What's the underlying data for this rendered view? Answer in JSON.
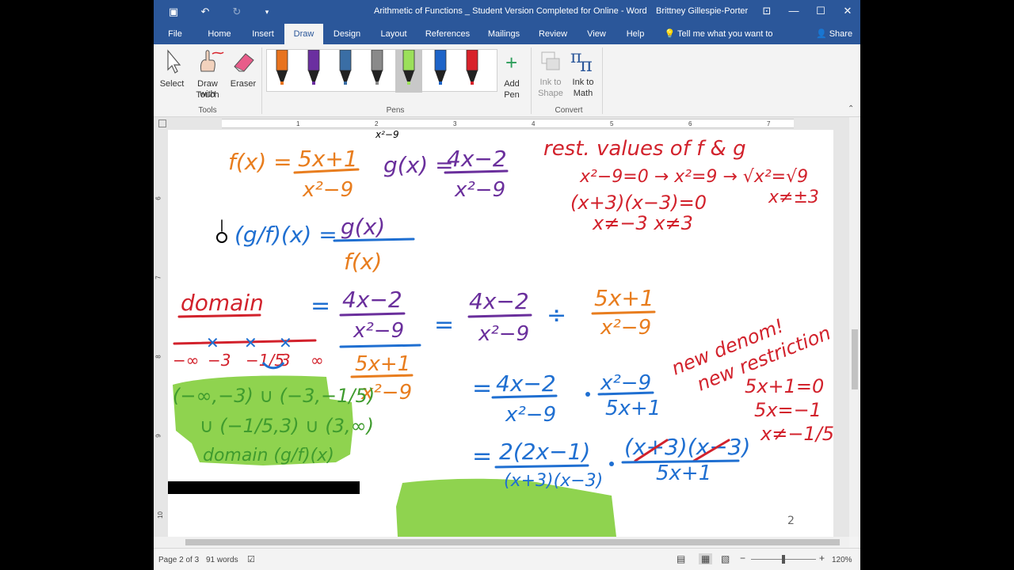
{
  "window": {
    "title": "Arithmetic of Functions _ Student Version Completed for Online  -  Word",
    "user": "Brittney Gillespie-Porter"
  },
  "tabs": [
    {
      "label": "File"
    },
    {
      "label": "Home"
    },
    {
      "label": "Insert"
    },
    {
      "label": "Draw"
    },
    {
      "label": "Design"
    },
    {
      "label": "Layout"
    },
    {
      "label": "References"
    },
    {
      "label": "Mailings"
    },
    {
      "label": "Review"
    },
    {
      "label": "View"
    },
    {
      "label": "Help"
    }
  ],
  "tell_me": "Tell me what you want to do",
  "share": "Share",
  "ribbon": {
    "tools": {
      "select": "Select",
      "draw_touch_1": "Draw with",
      "draw_touch_2": "Touch",
      "eraser": "Eraser",
      "group": "Tools"
    },
    "pens": {
      "group": "Pens",
      "add_pen_1": "Add",
      "add_pen_2": "Pen"
    },
    "convert": {
      "ink_shape_1": "Ink to",
      "ink_shape_2": "Shape",
      "ink_math_1": "Ink to",
      "ink_math_2": "Math",
      "group": "Convert"
    },
    "pen_colors": [
      "#e8731e",
      "#6b2fa0",
      "#3a6ea5",
      "#8a8a8a",
      "#9be05a",
      "#1e64c8",
      "#d8222a"
    ]
  },
  "ruler_numbers": [
    "1",
    "2",
    "3",
    "4",
    "5",
    "6",
    "7"
  ],
  "vruler_numbers": [
    "6",
    "7",
    "8",
    "9",
    "10"
  ],
  "handwriting": {
    "colors": {
      "orange": "#e87d1e",
      "purple": "#6a2f9c",
      "blue": "#1f6fd1",
      "red": "#d2222c",
      "green": "#3f9b2e",
      "highlight": "#8fd34f"
    },
    "top_cut": "x²−9",
    "f_lhs": "f(x) =",
    "f_num": "5x+1",
    "f_den": "x²−9",
    "g_lhs": "g(x) =",
    "g_num": "4x−2",
    "g_den": "x²−9",
    "rest_title": "rest. values of f & g",
    "rest_1": "x²−9=0 → x²=9 → √x²=√9",
    "rest_2": "(x+3)(x−3)=0",
    "rest_3": "x≠±3",
    "rest_4": "x≠−3  x≠3",
    "quot_lhs": "(g/f)(x) =",
    "quot_num": "g(x)",
    "quot_den": "f(x)",
    "domain_label": "domain",
    "nl_labels": [
      "−∞",
      "−3",
      "−1/5",
      "3",
      "∞"
    ],
    "eq1": "=",
    "step1_num": "4x−2",
    "step1_den": "x²−9",
    "step1_bnum": "5x+1",
    "step1_bden": "x²−9",
    "step2_a_num": "4x−2",
    "step2_a_den": "x²−9",
    "div_sign": "÷",
    "step2_b_num": "5x+1",
    "step2_b_den": "x²−9",
    "new_denom": "new denom!",
    "new_restriction": "new restriction",
    "nr_1": "5x+1=0",
    "nr_2": "5x=−1",
    "nr_3": "x≠−1/5",
    "step3_num": "4x−2",
    "step3_den": "x²−9",
    "step3_bnum": "x²−9",
    "step3_bden": "5x+1",
    "step4_num": "2(2x−1)",
    "step4_den": "(x+3)(x−3)",
    "step4_bnum": "(x+3)(x−3)",
    "step4_bden": "5x+1",
    "domain_ans_1": "(−∞,−3) ∪ (−3,−1/5)",
    "domain_ans_2": "∪ (−1/5,3) ∪ (3,∞)",
    "domain_ans_3": "domain (g/f)(x)",
    "page_number": "2"
  },
  "status": {
    "page": "Page 2 of 3",
    "words": "91 words",
    "zoom": "120%"
  }
}
